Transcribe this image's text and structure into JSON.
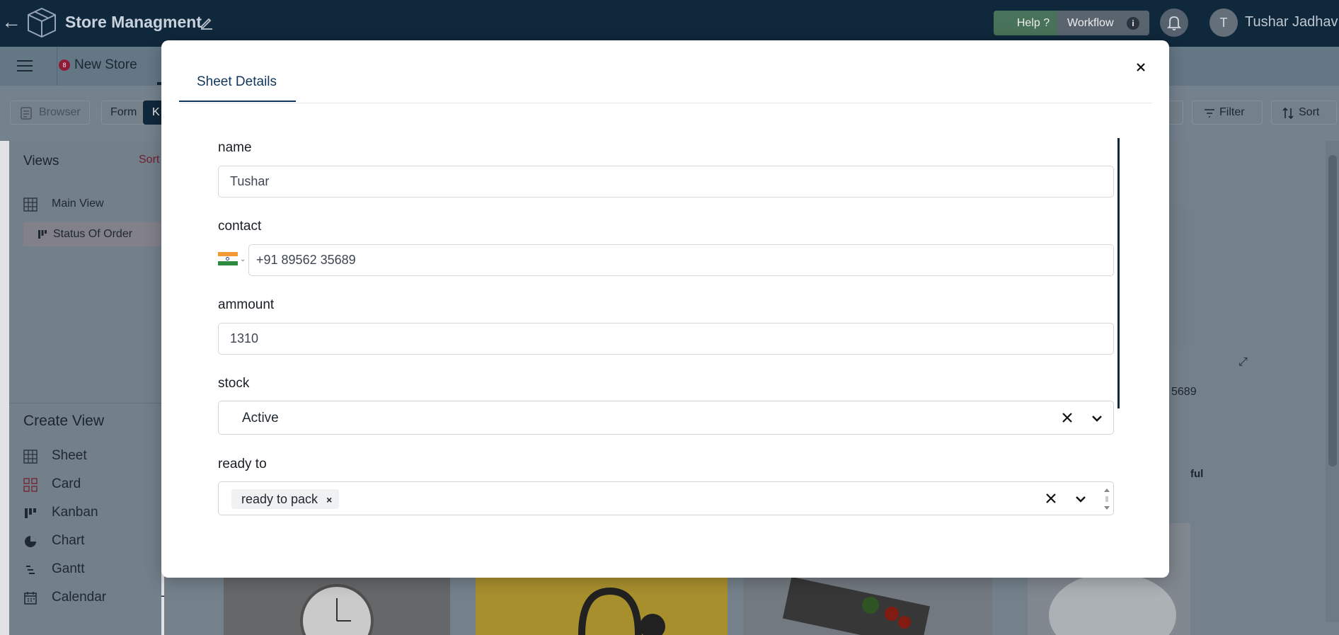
{
  "header": {
    "back_icon": "arrow-left-icon",
    "app_title": "Store Managment",
    "help_label": "Help ?",
    "workflow_label": "Workflow",
    "workflow_info": "i",
    "user_initial": "T",
    "user_name": "Tushar Jadhav"
  },
  "tabs": {
    "store_badge": "8",
    "store_label": "New Store"
  },
  "toolbar": {
    "browser_label": "Browser",
    "form_label": "Form",
    "kanban_partial": "K",
    "filter_label": "Filter",
    "sort_label": "Sort"
  },
  "sidebar": {
    "views_title": "Views",
    "views_sort": "Sort",
    "views": [
      {
        "label": "Main View"
      },
      {
        "label": "Status Of Order"
      }
    ],
    "create_view_title": "Create View",
    "create_items": [
      {
        "label": "Sheet"
      },
      {
        "label": "Card"
      },
      {
        "label": "Kanban"
      },
      {
        "label": "Chart"
      },
      {
        "label": "Gantt"
      },
      {
        "label": "Calendar"
      }
    ],
    "plus": "+"
  },
  "background": {
    "card_partial_phone": "5689",
    "card_partial_text": "ful"
  },
  "modal": {
    "tab_label": "Sheet Details",
    "fields": {
      "name_label": "name",
      "name_value": "Tushar",
      "contact_label": "contact",
      "contact_value": "+91 89562 35689",
      "ammount_label": "ammount",
      "ammount_value": "1310",
      "stock_label": "stock",
      "stock_value": "Active",
      "ready_label": "ready to",
      "ready_chip": "ready to pack",
      "ready_chip_remove": "×"
    }
  },
  "colors": {
    "topbar": "#0f2a3d",
    "accent": "#10365a",
    "help_green": "#4d7a5e"
  }
}
